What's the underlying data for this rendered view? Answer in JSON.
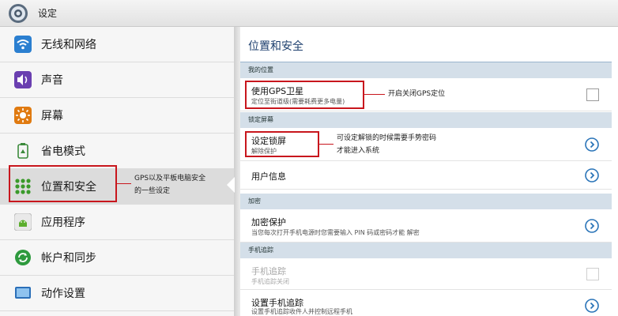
{
  "window": {
    "title": "设定"
  },
  "sidebar": {
    "items": [
      {
        "label": "无线和网络",
        "icon": "wifi-icon"
      },
      {
        "label": "声音",
        "icon": "speaker-icon"
      },
      {
        "label": "屏幕",
        "icon": "brightness-icon"
      },
      {
        "label": "省电模式",
        "icon": "battery-saver-icon"
      },
      {
        "label": "位置和安全",
        "icon": "location-grid-icon",
        "active": true
      },
      {
        "label": "应用程序",
        "icon": "android-app-icon"
      },
      {
        "label": "帐户和同步",
        "icon": "sync-icon"
      },
      {
        "label": "动作设置",
        "icon": "screen-motion-icon"
      }
    ],
    "annotation": {
      "line1": "GPS以及平板电脑安全",
      "line2": "的一些设定"
    }
  },
  "panel": {
    "title": "位置和安全",
    "sections": {
      "my_location": "我的位置",
      "screen_lock": "锁定屏幕",
      "encryption": "加密",
      "phone_tracking": "手机追踪"
    },
    "rows": {
      "gps": {
        "title": "使用GPS卫星",
        "sub": "定位至街道级(需要耗费更多电量)",
        "checked": false,
        "annotation": "开启关闭GPS定位"
      },
      "lock": {
        "title": "设定锁屏",
        "sub": "解除保护",
        "annotation_line1": "可设定解锁的时候需要手势密码",
        "annotation_line2": "才能进入系统"
      },
      "owner": {
        "title": "用户信息"
      },
      "encrypt": {
        "title": "加密保护",
        "sub": "当您每次打开手机电源时您需要输入 PIN 码或密码才能 解密"
      },
      "tracking": {
        "title": "手机追踪",
        "sub": "手机追踪关闭",
        "checked": false,
        "disabled": true
      },
      "tracking_setup": {
        "title": "设置手机追踪",
        "sub": "设置手机追踪收件人并控制远程手机"
      }
    }
  },
  "colors": {
    "accent_red": "#c8161d",
    "section_bg": "#d4dfe9",
    "chevron_blue": "#2a74b8"
  }
}
